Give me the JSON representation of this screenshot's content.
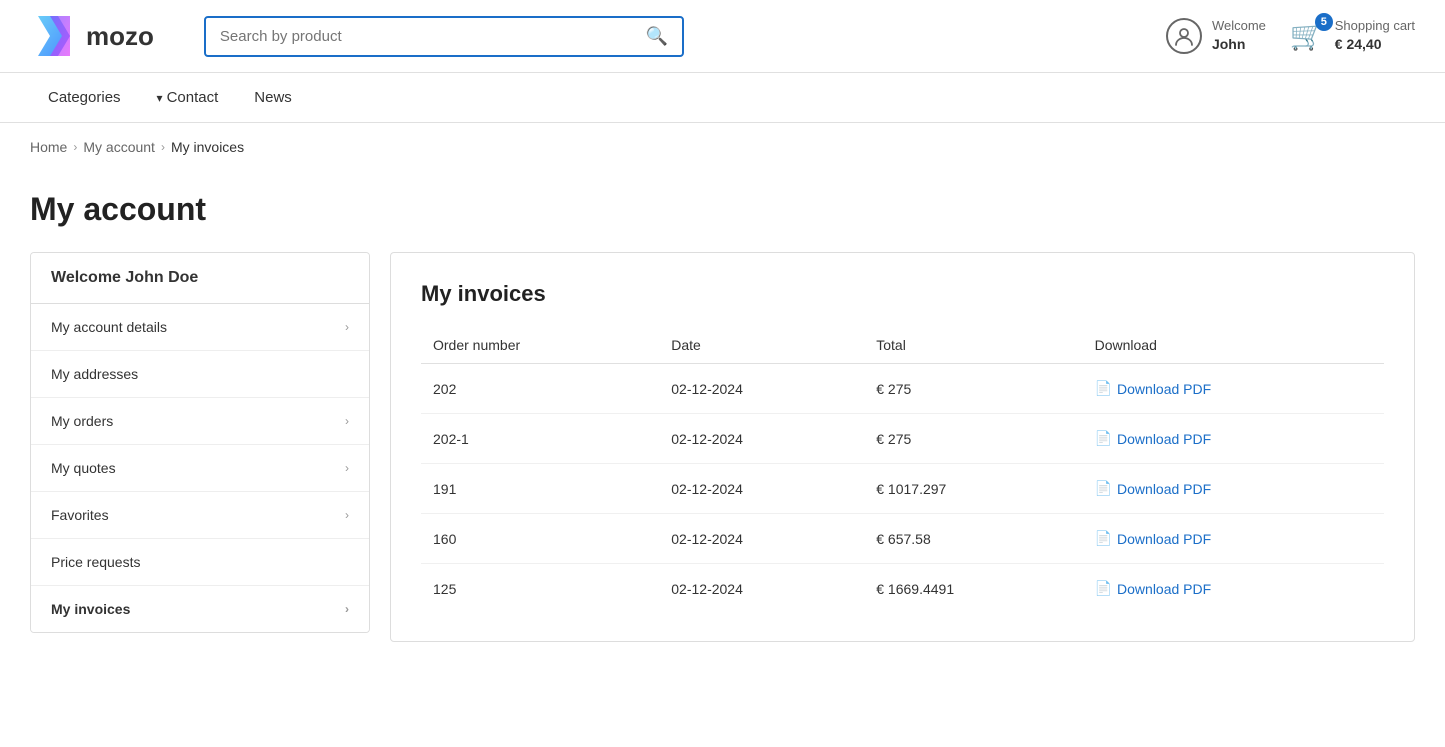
{
  "header": {
    "logo_text": "mozo",
    "search_placeholder": "Search by product",
    "user_welcome": "Welcome",
    "user_name": "John",
    "cart_label": "Shopping cart",
    "cart_price": "€ 24,40",
    "cart_count": "5"
  },
  "nav": {
    "items": [
      {
        "label": "Categories",
        "has_chevron": false
      },
      {
        "label": "Contact",
        "has_chevron": true
      },
      {
        "label": "News",
        "has_chevron": false
      }
    ]
  },
  "breadcrumb": {
    "home": "Home",
    "account": "My account",
    "current": "My invoices"
  },
  "page": {
    "title": "My account"
  },
  "sidebar": {
    "welcome": "Welcome John Doe",
    "items": [
      {
        "label": "My account details",
        "active": false
      },
      {
        "label": "My addresses",
        "active": false
      },
      {
        "label": "My orders",
        "active": false
      },
      {
        "label": "My quotes",
        "active": false
      },
      {
        "label": "Favorites",
        "active": false
      },
      {
        "label": "Price requests",
        "active": false
      },
      {
        "label": "My invoices",
        "active": true
      }
    ]
  },
  "invoices": {
    "title": "My invoices",
    "columns": [
      "Order number",
      "Date",
      "Total",
      "Download"
    ],
    "rows": [
      {
        "order_number": "202",
        "date": "02-12-2024",
        "total": "€ 275",
        "download_label": "Download PDF"
      },
      {
        "order_number": "202-1",
        "date": "02-12-2024",
        "total": "€ 275",
        "download_label": "Download PDF"
      },
      {
        "order_number": "191",
        "date": "02-12-2024",
        "total": "€ 1017.297",
        "download_label": "Download PDF"
      },
      {
        "order_number": "160",
        "date": "02-12-2024",
        "total": "€ 657.58",
        "download_label": "Download PDF"
      },
      {
        "order_number": "125",
        "date": "02-12-2024",
        "total": "€ 1669.4491",
        "download_label": "Download PDF"
      }
    ]
  }
}
